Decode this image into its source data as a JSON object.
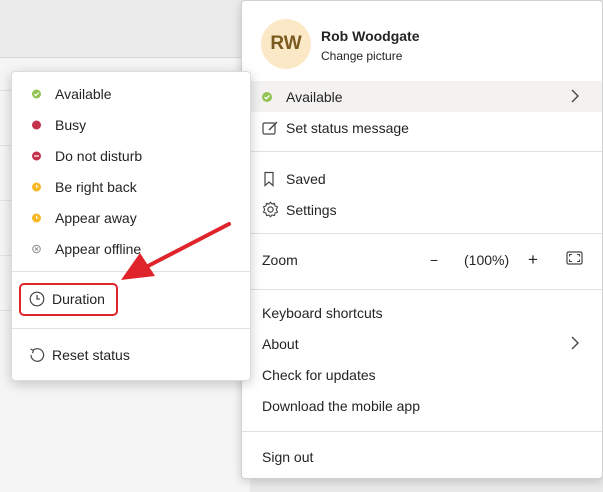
{
  "profile": {
    "initials": "RW",
    "name": "Rob Woodgate",
    "change_picture": "Change picture",
    "status_label": "Available",
    "set_status_message": "Set status message",
    "saved": "Saved",
    "settings": "Settings",
    "zoom_label": "Zoom",
    "zoom_minus": "−",
    "zoom_value": "(100%)",
    "zoom_plus": "+",
    "keyboard_shortcuts": "Keyboard shortcuts",
    "about": "About",
    "check_updates": "Check for updates",
    "download_app": "Download the mobile app",
    "sign_out": "Sign out"
  },
  "status_menu": {
    "items": [
      {
        "label": "Available",
        "color": "#92c353"
      },
      {
        "label": "Busy",
        "color": "#c4314b"
      },
      {
        "label": "Do not disturb",
        "color": "#c4314b"
      },
      {
        "label": "Be right back",
        "color": "#f8b824"
      },
      {
        "label": "Appear away",
        "color": "#f8b824"
      },
      {
        "label": "Appear offline",
        "color": "#8a8886"
      }
    ],
    "duration": "Duration",
    "reset_status": "Reset status"
  },
  "colors": {
    "accent_red": "#e0242b",
    "avatar_bg": "#fbe8c6"
  },
  "icons": {
    "available": "check-circle-icon",
    "duration": "clock-icon",
    "reset": "reset-icon",
    "saved": "bookmark-icon",
    "settings": "gear-icon",
    "status_message": "edit-icon",
    "fullscreen": "fullscreen-icon",
    "chevron": "chevron-right-icon"
  }
}
